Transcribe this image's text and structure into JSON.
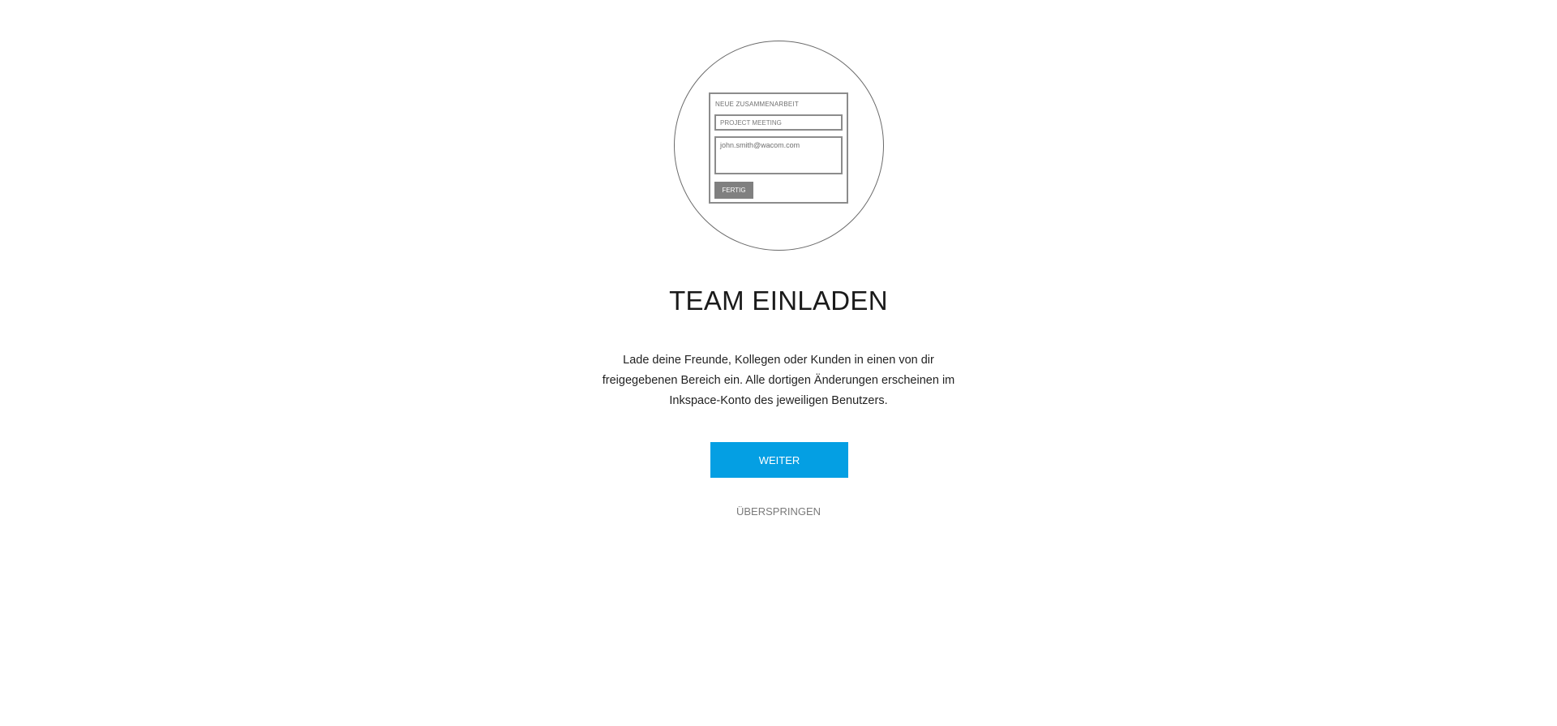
{
  "illustration": {
    "card_title": "NEUE ZUSAMMENARBEIT",
    "input_value": "PROJECT MEETING",
    "textarea_value": "john.smith@wacom.com",
    "button_label": "FERTIG"
  },
  "main": {
    "title": "TEAM EINLADEN",
    "description": "Lade deine Freunde, Kollegen oder Kunden in einen von dir freigegebenen Bereich ein. Alle dortigen Änderungen erscheinen im Inkspace-Konto des jeweiligen Benutzers.",
    "primary_label": "WEITER",
    "skip_label": "ÜBERSPRINGEN"
  },
  "colors": {
    "primary": "#049fe3",
    "mock_button": "#808080",
    "outline": "#6b6b6b"
  }
}
